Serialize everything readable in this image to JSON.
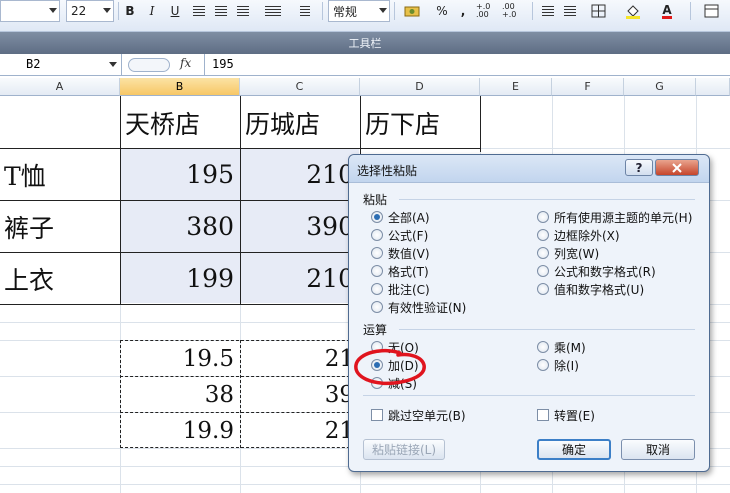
{
  "ribbon": {
    "font_size": "22",
    "bold": "B",
    "italic": "I",
    "underline": "U",
    "number_format": "常规",
    "percent": "%",
    "comma": ",",
    "inc_decimal": "+.0 .00",
    "dec_decimal": ".00 +.0",
    "font_color_glyph": "A"
  },
  "toolbar_title": "工具栏",
  "formula_bar": {
    "cell_ref": "B2",
    "fx": "fx",
    "value": "195"
  },
  "columns": [
    "A",
    "B",
    "C",
    "D",
    "E",
    "F",
    "G"
  ],
  "table": {
    "headers": [
      "天桥店",
      "历城店",
      "历下店"
    ],
    "rows": [
      {
        "label": "T恤",
        "b": "195",
        "c": "210"
      },
      {
        "label": "裤子",
        "b": "380",
        "c": "390"
      },
      {
        "label": "上衣",
        "b": "199",
        "c": "210"
      }
    ]
  },
  "copied": [
    {
      "b": "19.5",
      "c": "21"
    },
    {
      "b": "38",
      "c": "39"
    },
    {
      "b": "19.9",
      "c": "21"
    }
  ],
  "dialog": {
    "title": "选择性粘贴",
    "help": "?",
    "paste_label": "粘贴",
    "paste_left": [
      "全部(A)",
      "公式(F)",
      "数值(V)",
      "格式(T)",
      "批注(C)",
      "有效性验证(N)"
    ],
    "paste_right": [
      "所有使用源主题的单元(H)",
      "边框除外(X)",
      "列宽(W)",
      "公式和数字格式(R)",
      "值和数字格式(U)"
    ],
    "op_label": "运算",
    "op_left": [
      "无(O)",
      "加(D)",
      "减(S)"
    ],
    "op_right": [
      "乘(M)",
      "除(I)"
    ],
    "skip_blanks": "跳过空单元(B)",
    "transpose": "转置(E)",
    "paste_link": "粘贴链接(L)",
    "ok": "确定",
    "cancel": "取消"
  },
  "colors": {
    "selected_header": "#f7c766",
    "highlight": "#e7ebf6",
    "annotation": "#e0141e"
  }
}
